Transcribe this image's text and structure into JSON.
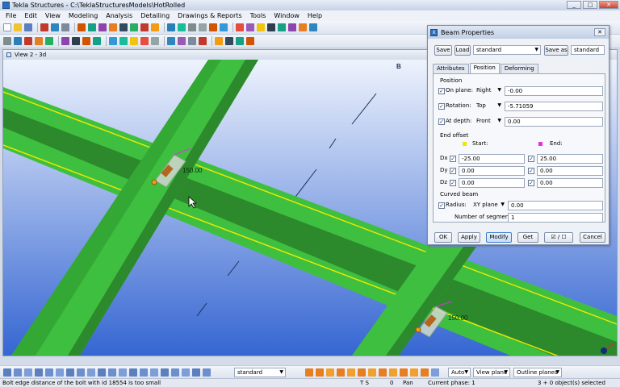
{
  "window": {
    "title": "Tekla Structures - C:\\TeklaStructuresModels\\HotRolled",
    "min": "_",
    "max": "□",
    "close": "✕"
  },
  "menu": [
    "File",
    "Edit",
    "View",
    "Modeling",
    "Analysis",
    "Detailing",
    "Drawings & Reports",
    "Tools",
    "Window",
    "Help"
  ],
  "view": {
    "title": "View 2 - 3d",
    "corner_label": "B",
    "dim_label_1": "150.00",
    "dim_label_2": "150.00"
  },
  "dialog": {
    "title": "Beam Properties",
    "close": "✕",
    "save_label": "Save",
    "load_label": "Load",
    "preset_value": "standard",
    "save_as_label": "Save as",
    "save_as_value": "standard",
    "tabs": [
      "Attributes",
      "Position",
      "Deforming"
    ],
    "active_tab": "Position",
    "position_group": "Position",
    "on_plane_label": "On plane:",
    "on_plane_option": "Right",
    "on_plane_value": "-0.00",
    "rotation_label": "Rotation:",
    "rotation_option": "Top",
    "rotation_value": "-5.71059",
    "at_depth_label": "At depth:",
    "at_depth_option": "Front",
    "at_depth_value": "0.00",
    "end_offset_group": "End offset",
    "start_label": "Start:",
    "end_label": "End:",
    "dx_label": "Dx",
    "dx_start": "-25.00",
    "dx_end": "25.00",
    "dy_label": "Dy",
    "dy_start": "0.00",
    "dy_end": "0.00",
    "dz_label": "Dz",
    "dz_start": "0.00",
    "dz_end": "0.00",
    "curved_group": "Curved beam",
    "radius_label": "Radius:",
    "radius_option": "XY plane",
    "radius_value": "0.00",
    "segments_label": "Number of segments:",
    "segments_value": "1",
    "ok_label": "OK",
    "apply_label": "Apply",
    "modify_label": "Modify",
    "get_label": "Get",
    "toggle_label": "☑ / ☐",
    "cancel_label": "Cancel",
    "colors": {
      "start_marker": "#f2e600",
      "end_marker": "#e62ee6"
    }
  },
  "bottom_toolbar": {
    "standard_value": "standard",
    "auto_value": "Auto",
    "view_plane_value": "View plane",
    "outline_value": "Outline planes"
  },
  "status": {
    "message": "Bolt edge distance of the bolt with id 18554 is too small",
    "ts": "T S",
    "zero": "0",
    "pan": "Pan",
    "phase": "Current phase: 1",
    "selected": "3 + 0 object(s) selected"
  },
  "colors": {
    "beam_green": "#3fbf3f",
    "beam_dark": "#2c8a2c",
    "beam_edge_yellow": "#e8e800",
    "sky_top": "#e6eefc",
    "sky_bottom": "#3b6fd8"
  }
}
